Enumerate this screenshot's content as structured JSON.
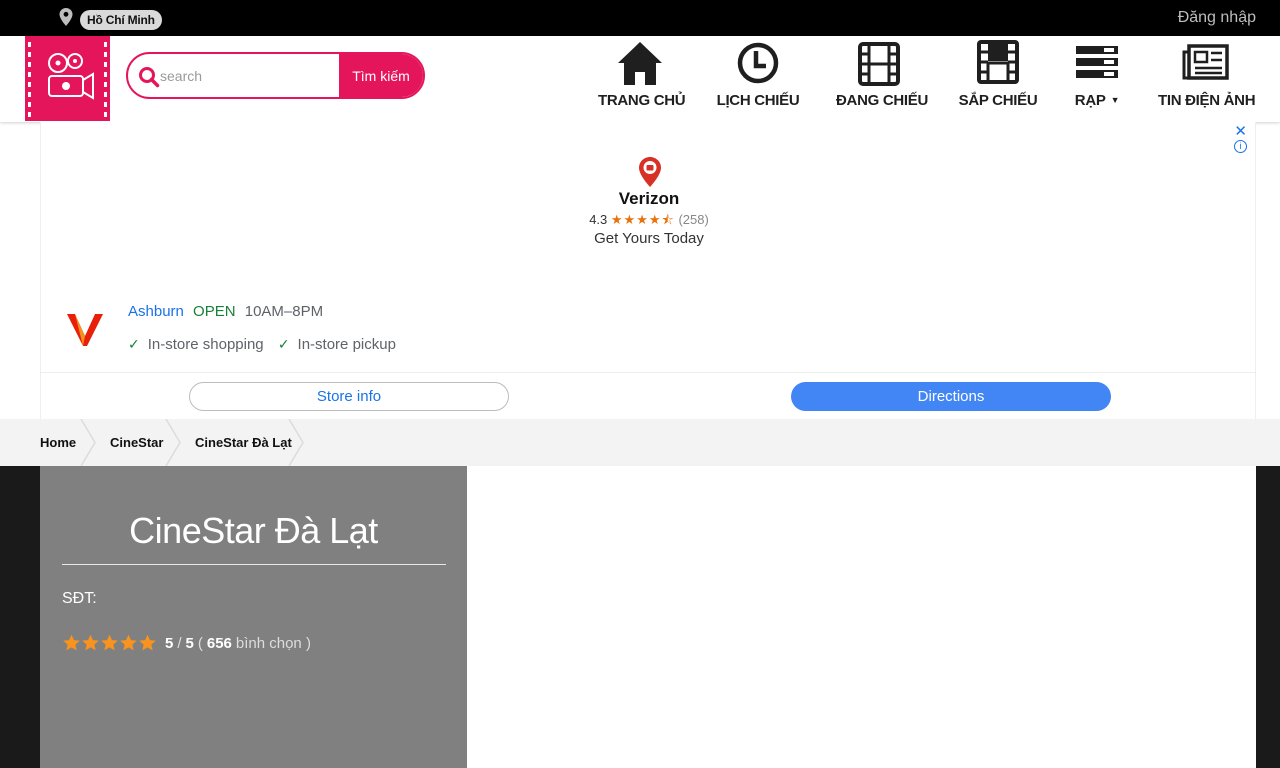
{
  "topbar": {
    "city": "Hồ Chí Minh",
    "login": "Đăng nhập"
  },
  "search": {
    "placeholder": "search",
    "button_label": "Tìm kiếm"
  },
  "nav": {
    "home": "TRANG CHỦ",
    "schedule": "LỊCH CHIẾU",
    "now_showing": "ĐANG CHIẾU",
    "coming_soon": "SẮP CHIẾU",
    "cinemas": "RẠP",
    "news": "TIN ĐIỆN ẢNH"
  },
  "ad": {
    "brand": "Verizon",
    "rating": "4.3",
    "stars": "★★★★⯪",
    "review_count": "(258)",
    "tagline": "Get Yours Today",
    "store_name": "Ashburn",
    "store_status": "OPEN",
    "store_hours": "10AM–8PM",
    "feature_1": "In-store shopping",
    "feature_2": "In-store pickup",
    "store_info_label": "Store info",
    "directions_label": "Directions",
    "close_symbol": "✕",
    "info_symbol": "i"
  },
  "breadcrumb": {
    "home": "Home",
    "chain": "CineStar",
    "current": "CineStar Đà Lạt"
  },
  "cinema": {
    "title": "CineStar Đà Lạt",
    "phone_label": "SĐT:",
    "rating_value": "5",
    "rating_sep": "/",
    "rating_max": "5",
    "open_paren": "(",
    "votes": "656",
    "votes_label": "bình chọn )",
    "rating_fraction": 1.0
  },
  "colors": {
    "brand_pink": "#e4155b",
    "star_orange": "#f7931e",
    "ad_blue": "#4285f4"
  }
}
